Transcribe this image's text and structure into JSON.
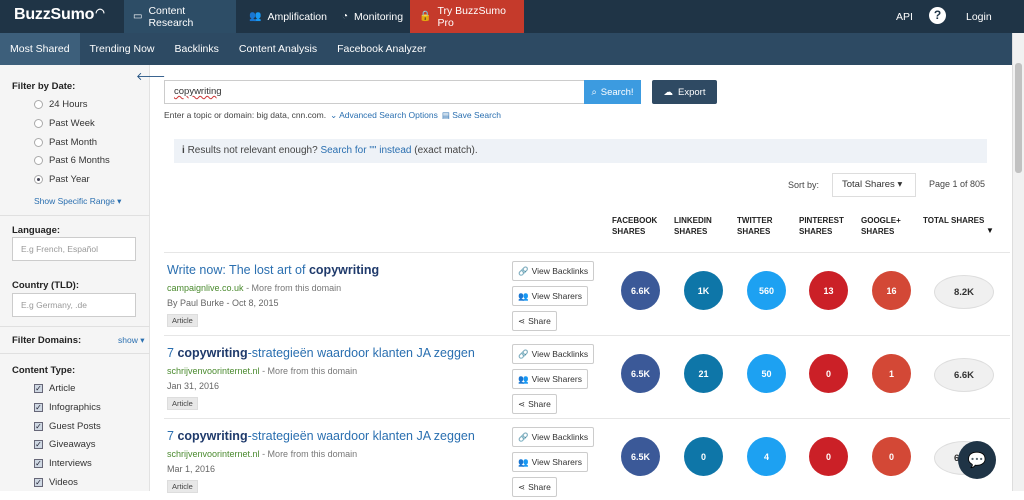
{
  "brand": {
    "logo": "BuzzSumo"
  },
  "topnav": {
    "content_research": "Content Research",
    "amplification": "Amplification",
    "monitoring": "Monitoring",
    "try_pro": "Try BuzzSumo Pro",
    "api": "API",
    "login": "Login"
  },
  "subnav": [
    "Most Shared",
    "Trending Now",
    "Backlinks",
    "Content Analysis",
    "Facebook Analyzer"
  ],
  "sidebar": {
    "date_header": "Filter by Date:",
    "date_options": [
      "24 Hours",
      "Past Week",
      "Past Month",
      "Past 6 Months",
      "Past Year"
    ],
    "date_selected": "Past Year",
    "specific_range": "Show Specific Range",
    "language_header": "Language:",
    "language_placeholder": "E.g French, Español",
    "country_header": "Country (TLD):",
    "country_placeholder": "E.g Germany, .de",
    "domains_header": "Filter Domains:",
    "domains_show": "show",
    "content_type_header": "Content Type:",
    "content_types": [
      "Article",
      "Infographics",
      "Guest Posts",
      "Giveaways",
      "Interviews",
      "Videos"
    ]
  },
  "search": {
    "value": "copywriting",
    "button": "Search!",
    "export": "Export",
    "hint": "Enter a topic or domain: big data, cnn.com.",
    "advanced": "Advanced Search Options",
    "save": "Save Search"
  },
  "notice": {
    "text": "Results not relevant enough?",
    "link": "Search for \"\" instead",
    "suffix": "(exact match)."
  },
  "sort": {
    "label": "Sort by:",
    "value": "Total Shares",
    "page": "Page 1 of 805"
  },
  "columns": [
    [
      "FACEBOOK",
      "SHARES"
    ],
    [
      "LINKEDIN",
      "SHARES"
    ],
    [
      "TWITTER",
      "SHARES"
    ],
    [
      "PINTEREST",
      "SHARES"
    ],
    [
      "GOOGLE+",
      "SHARES"
    ],
    [
      "TOTAL SHARES",
      ""
    ]
  ],
  "actions": {
    "backlinks": "View Backlinks",
    "sharers": "View Sharers",
    "share": "Share"
  },
  "more_from": "- More from this domain",
  "results": [
    {
      "title_pre": "Write now: The lost art of ",
      "title_kw": "copywriting",
      "title_post": "",
      "domain": "campaignlive.co.uk",
      "meta": "By Paul Burke - Oct 8, 2015",
      "tag": "Article",
      "facebook": "6.6K",
      "linkedin": "1K",
      "twitter": "560",
      "pinterest": "13",
      "google": "16",
      "total": "8.2K"
    },
    {
      "title_pre": "7 ",
      "title_kw": "copywriting",
      "title_post": "-strategieën waardoor klanten JA zeggen",
      "domain": "schrijvenvoorinternet.nl",
      "meta": "Jan 31, 2016",
      "tag": "Article",
      "facebook": "6.5K",
      "linkedin": "21",
      "twitter": "50",
      "pinterest": "0",
      "google": "1",
      "total": "6.6K"
    },
    {
      "title_pre": "7 ",
      "title_kw": "copywriting",
      "title_post": "-strategieën waardoor klanten JA zeggen",
      "domain": "schrijvenvoorinternet.nl",
      "meta": "Mar 1, 2016",
      "tag": "Article",
      "facebook": "6.5K",
      "linkedin": "0",
      "twitter": "4",
      "pinterest": "0",
      "google": "0",
      "total": "6.6K"
    }
  ],
  "colors": {
    "facebook": "#3b5998",
    "linkedin": "#0e76a8",
    "twitter": "#1da1f2",
    "pinterest": "#cb2027",
    "google": "#d34836"
  }
}
